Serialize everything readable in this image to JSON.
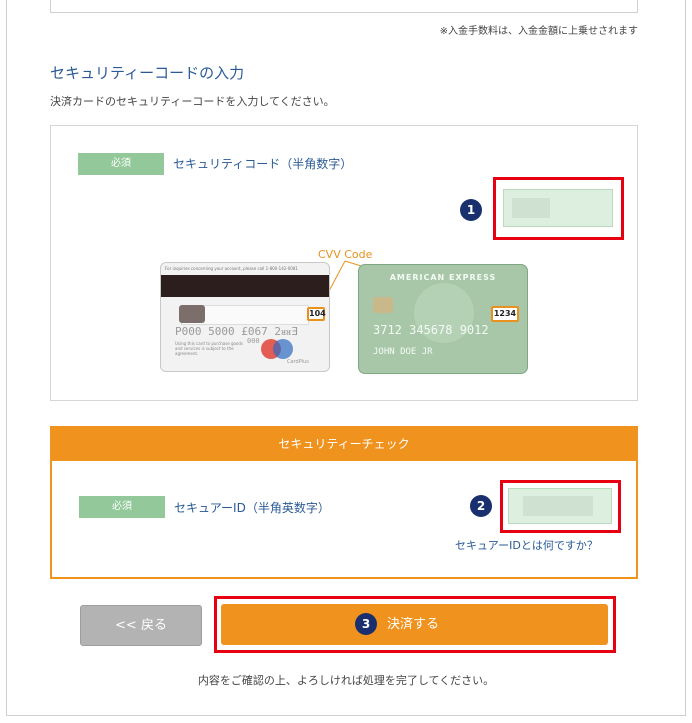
{
  "fee_note": "※入金手数料は、入金金額に上乗せされます",
  "section": {
    "title": "セキュリティーコードの入力",
    "desc": "決済カードのセキュリティーコードを入力してください。"
  },
  "security_code": {
    "required_badge": "必須",
    "label": "セキュリティコード（半角数字）",
    "step": "1"
  },
  "illustration": {
    "cvv_label": "CVV Code",
    "back_card": {
      "top_text": "For inquiries concerning your account, please call 1-800-142-0081",
      "embossed_number": "P000 5000 £067 2ᴚᴚƎ",
      "small_digits": "000",
      "cvv": "104",
      "fine_print": "Using this card to purchase goods and services is subject to the agreement.",
      "brand": "CardPlus"
    },
    "amex_card": {
      "brand": "AMERICAN EXPRESS",
      "code": "1234",
      "number": "3712 345678 9012",
      "holder": "JOHN DOE JR"
    }
  },
  "security_check": {
    "header": "セキュリティーチェック",
    "required_badge": "必須",
    "label": "セキュアーID（半角英数字）",
    "step": "2",
    "help_link": "セキュアーIDとは何ですか？"
  },
  "buttons": {
    "back": "<< 戻る",
    "pay": "決済する",
    "pay_step": "3"
  },
  "confirm_note": "内容をご確認の上、よろしければ処理を完了してください。"
}
